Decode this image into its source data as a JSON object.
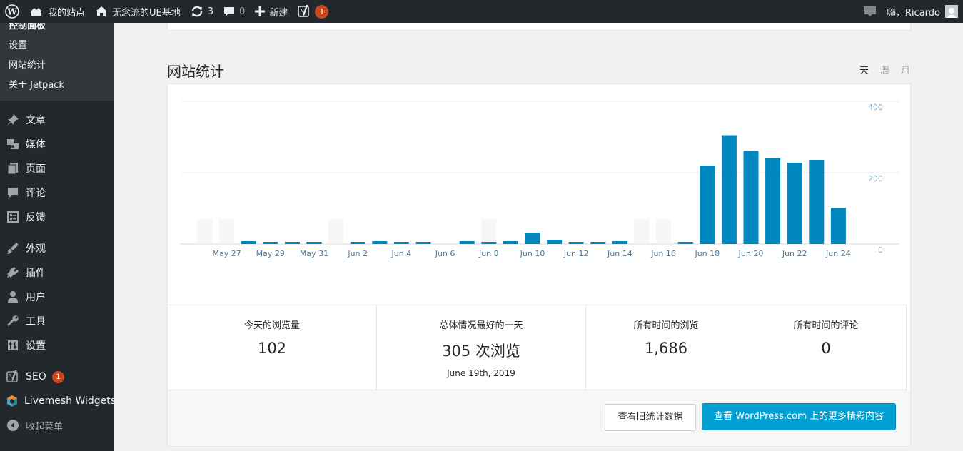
{
  "adminbar": {
    "site_name": "我的站点",
    "blog_name": "无念流的UE基地",
    "updates_count": "3",
    "comments_count": "0",
    "new_label": "新建",
    "seo_badge": "1",
    "greeting": "嗨，Ricardo"
  },
  "sidebar": {
    "submenu": [
      "控制面板",
      "设置",
      "网站统计",
      "关于 Jetpack"
    ],
    "menu_group1": [
      {
        "label": "文章",
        "icon": "pin-icon"
      },
      {
        "label": "媒体",
        "icon": "media-icon"
      },
      {
        "label": "页面",
        "icon": "page-icon"
      },
      {
        "label": "评论",
        "icon": "comment-icon"
      },
      {
        "label": "反馈",
        "icon": "feedback-icon"
      }
    ],
    "menu_group2": [
      {
        "label": "外观",
        "icon": "appearance-icon"
      },
      {
        "label": "插件",
        "icon": "plugin-icon"
      },
      {
        "label": "用户",
        "icon": "user-icon"
      },
      {
        "label": "工具",
        "icon": "wrench-icon"
      },
      {
        "label": "设置",
        "icon": "settings-icon"
      }
    ],
    "seo_label": "SEO",
    "seo_badge": "1",
    "livemesh_label": "Livemesh Widgets",
    "collapse_label": "收起菜单"
  },
  "stats": {
    "title": "网站统计",
    "periods": [
      "天",
      "周",
      "月"
    ],
    "active_period": "天",
    "summary": {
      "today_label": "今天的浏览量",
      "today_value": "102",
      "best_label": "总体情况最好的一天",
      "best_value": "305 次浏览",
      "best_date": "June 19th, 2019",
      "alltime_views_label": "所有时间的浏览",
      "alltime_views_value": "1,686",
      "alltime_comments_label": "所有时间的评论",
      "alltime_comments_value": "0"
    },
    "buttons": {
      "legacy": "查看旧统计数据",
      "more": "查看 WordPress.com 上的更多精彩内容"
    }
  },
  "colors": {
    "bar": "#0087be",
    "weekend": "#f6f6f6",
    "admin_dark": "#23282d",
    "primary_button": "#00a0d2",
    "badge": "#ca4a1f"
  },
  "chart_data": {
    "type": "bar",
    "categories": [
      "May 26",
      "May 27",
      "May 28",
      "May 29",
      "May 30",
      "May 31",
      "Jun 1",
      "Jun 2",
      "Jun 3",
      "Jun 4",
      "Jun 5",
      "Jun 6",
      "Jun 7",
      "Jun 8",
      "Jun 9",
      "Jun 10",
      "Jun 11",
      "Jun 12",
      "Jun 13",
      "Jun 14",
      "Jun 15",
      "Jun 16",
      "Jun 17",
      "Jun 18",
      "Jun 19",
      "Jun 20",
      "Jun 21",
      "Jun 22",
      "Jun 23",
      "Jun 24"
    ],
    "tick_labels": [
      "May 27",
      "May 29",
      "May 31",
      "Jun 2",
      "Jun 4",
      "Jun 6",
      "Jun 8",
      "Jun 10",
      "Jun 12",
      "Jun 14",
      "Jun 16",
      "Jun 18",
      "Jun 20",
      "Jun 22",
      "Jun 24"
    ],
    "values": [
      0,
      0,
      8,
      4,
      4,
      4,
      0,
      4,
      8,
      4,
      4,
      0,
      8,
      4,
      8,
      32,
      12,
      4,
      4,
      8,
      0,
      0,
      4,
      220,
      305,
      262,
      240,
      228,
      236,
      102
    ],
    "weekend_days": [
      "May 26",
      "May 27",
      "Jun 1",
      "Jun 8 ",
      "Jun 15",
      "Jun 16"
    ],
    "yticks": [
      0,
      200,
      400
    ],
    "ylim": [
      0,
      400
    ],
    "grid": true
  }
}
